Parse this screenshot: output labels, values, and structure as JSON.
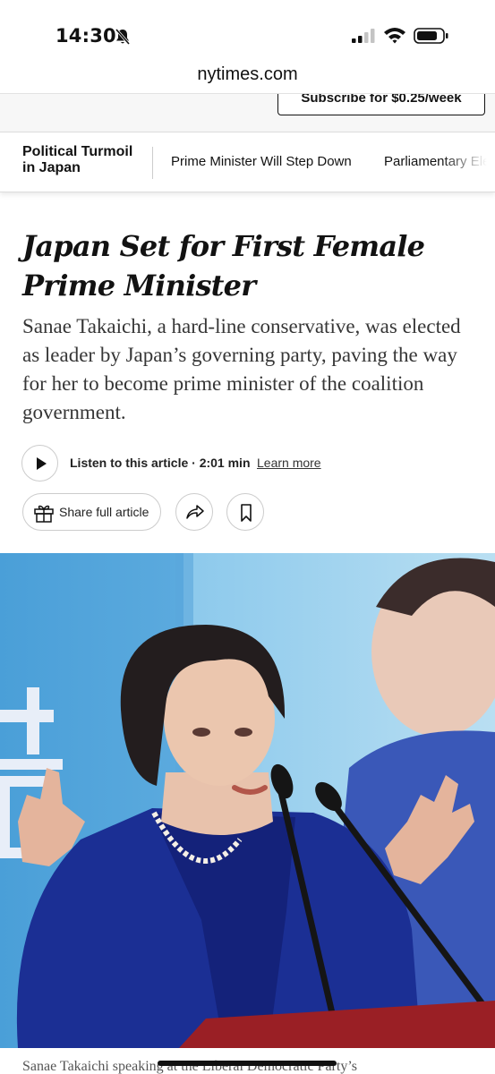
{
  "status_bar": {
    "time": "14:30"
  },
  "browser": {
    "url": "nytimes.com"
  },
  "subscribe": {
    "label": "Subscribe for $0.25/week"
  },
  "nav": {
    "section_title": "Political Turmoil in Japan",
    "links": [
      "Prime Minister Will Step Down",
      "Parliamentary Ele"
    ]
  },
  "article": {
    "headline": "Japan Set for First Female Prime Minister",
    "summary": "Sanae Takaichi, a hard-line conservative, was elected as leader by Japan’s governing party, paving the way for her to become prime minister of the coalition government.",
    "listen_label": "Listen to this article · 2:01 min",
    "learn_more": "Learn more",
    "share_label": "Share full article",
    "caption": "Sanae Takaichi speaking at the Liberal Democratic Party’s"
  },
  "colors": {
    "text": "#121212",
    "photo_background_blue": "#6cb0e2",
    "jacket_blue": "#1b2f94"
  }
}
